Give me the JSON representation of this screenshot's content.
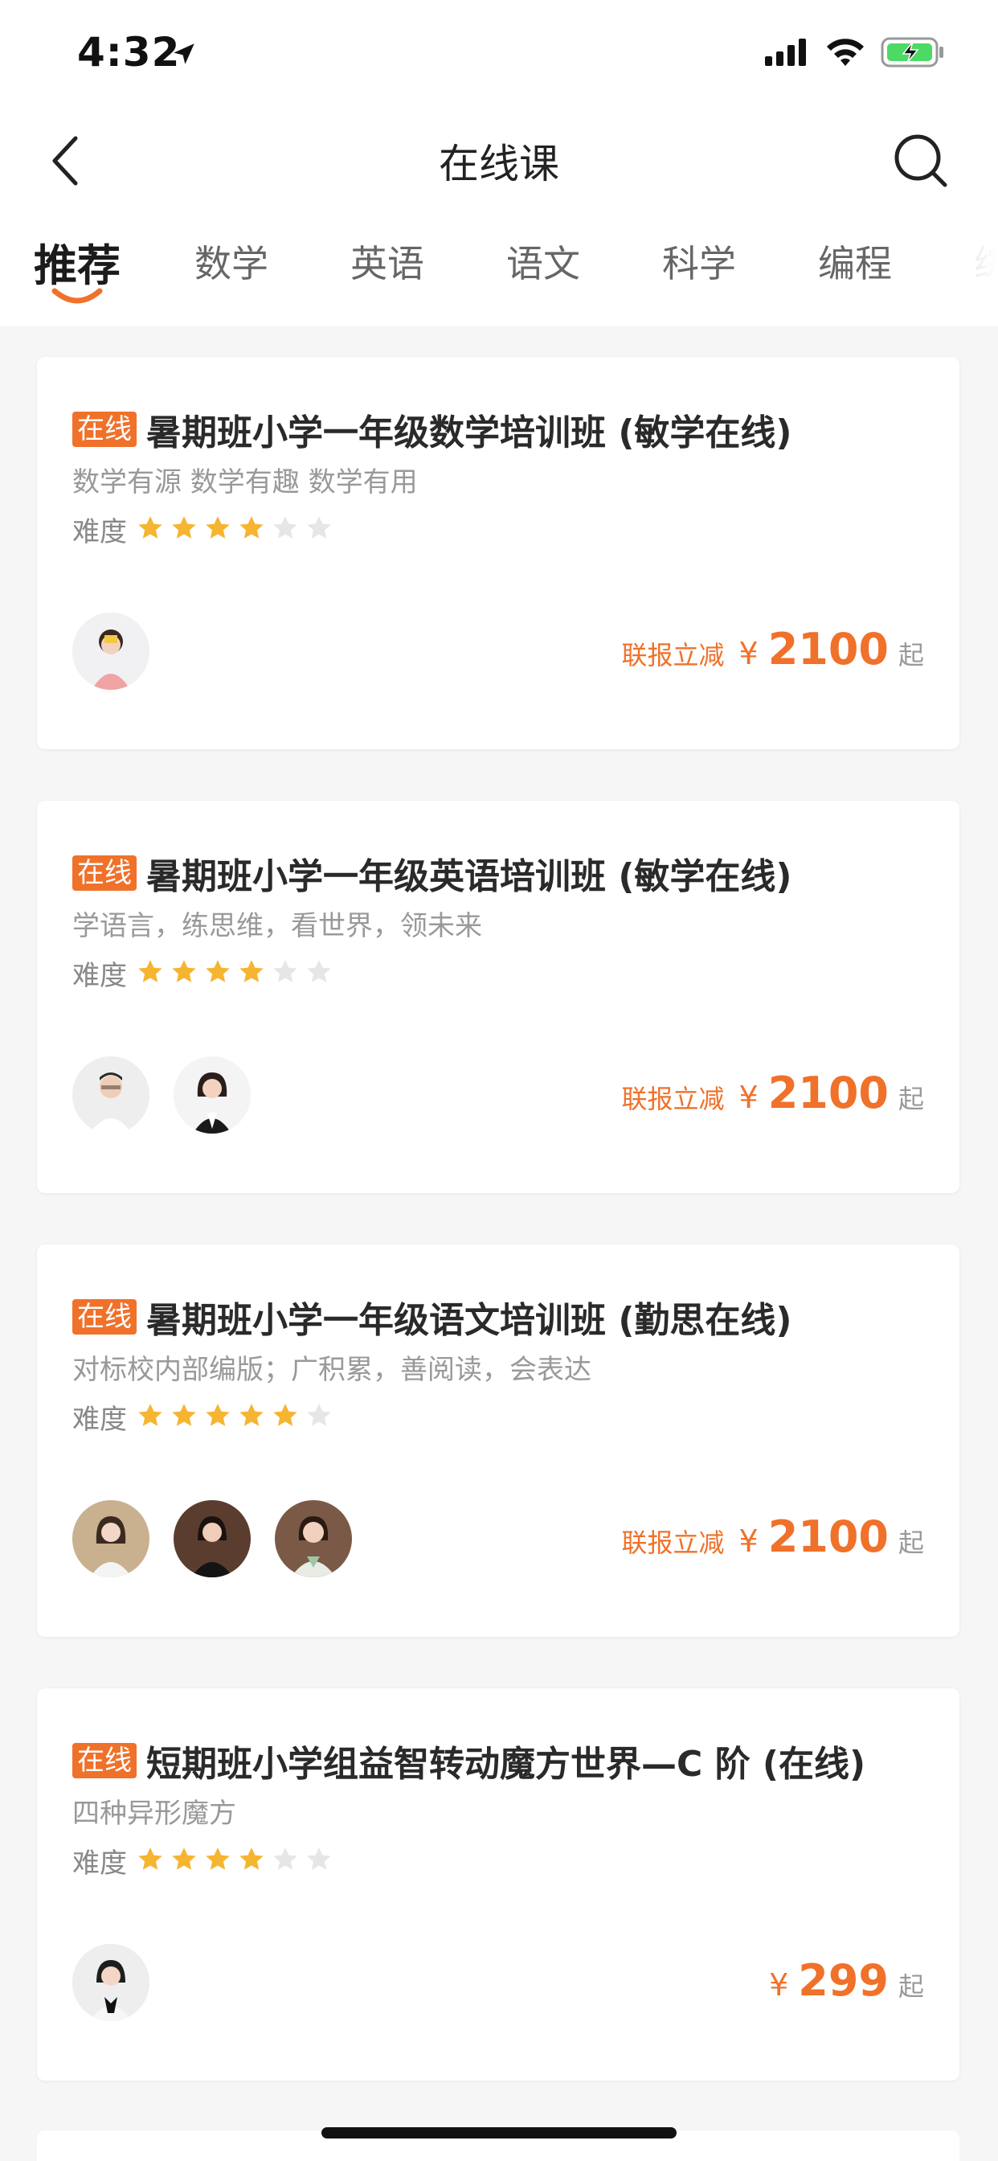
{
  "status_bar": {
    "time": "4:32"
  },
  "header": {
    "title": "在线课"
  },
  "tabs": [
    {
      "label": "推荐",
      "active": true
    },
    {
      "label": "数学",
      "active": false
    },
    {
      "label": "英语",
      "active": false
    },
    {
      "label": "语文",
      "active": false
    },
    {
      "label": "科学",
      "active": false
    },
    {
      "label": "编程",
      "active": false
    },
    {
      "label": "综",
      "active": false
    }
  ],
  "courses": [
    {
      "tag": "在线",
      "title": "暑期班小学一年级数学培训班 (敏学在线)",
      "subtitle": "数学有源 数学有趣 数学有用",
      "difficulty_label": "难度",
      "difficulty": 4,
      "difficulty_max": 6,
      "teacher_count": 1,
      "discount_label": "联报立减",
      "currency": "¥",
      "price": "2100",
      "price_suffix": "起"
    },
    {
      "tag": "在线",
      "title": "暑期班小学一年级英语培训班 (敏学在线)",
      "subtitle": "学语言，练思维，看世界，领未来",
      "difficulty_label": "难度",
      "difficulty": 4,
      "difficulty_max": 6,
      "teacher_count": 2,
      "discount_label": "联报立减",
      "currency": "¥",
      "price": "2100",
      "price_suffix": "起"
    },
    {
      "tag": "在线",
      "title": "暑期班小学一年级语文培训班 (勤思在线)",
      "subtitle": "对标校内部编版；广积累，善阅读，会表达",
      "difficulty_label": "难度",
      "difficulty": 5,
      "difficulty_max": 6,
      "teacher_count": 3,
      "discount_label": "联报立减",
      "currency": "¥",
      "price": "2100",
      "price_suffix": "起"
    },
    {
      "tag": "在线",
      "title": "短期班小学组益智转动魔方世界—C 阶 (在线)",
      "subtitle": "四种异形魔方",
      "difficulty_label": "难度",
      "difficulty": 4,
      "difficulty_max": 6,
      "teacher_count": 1,
      "discount_label": "",
      "currency": "¥",
      "price": "299",
      "price_suffix": "起"
    }
  ],
  "colors": {
    "accent": "#f0712a",
    "star_filled": "#f5b531",
    "star_empty": "#e6e6e6",
    "background": "#f6f6f6"
  },
  "icons": {
    "back": "chevron-left-icon",
    "search": "search-icon",
    "star": "star-icon"
  }
}
